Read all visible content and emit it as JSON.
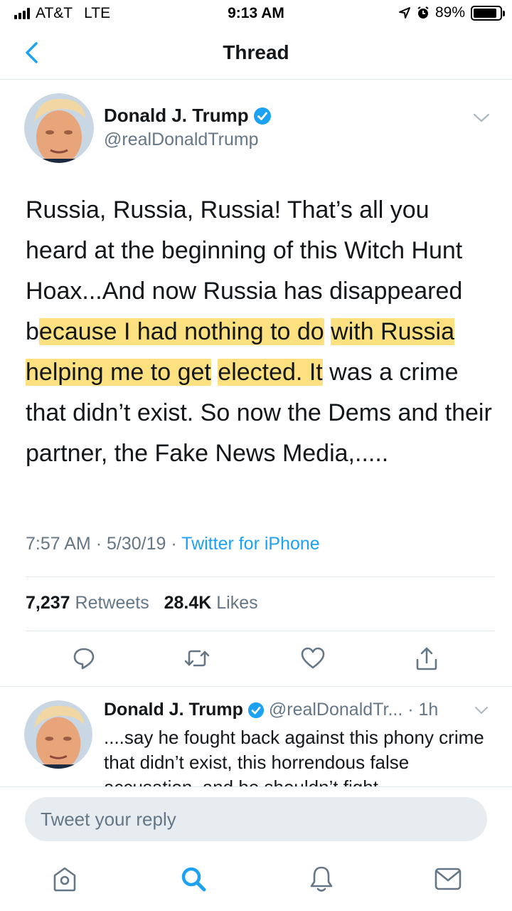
{
  "status_bar": {
    "carrier": "AT&T",
    "network": "LTE",
    "time": "9:13 AM",
    "battery_percent": "89%",
    "battery_level": 0.89
  },
  "nav": {
    "title": "Thread",
    "back_icon": "chevron-left-icon"
  },
  "colors": {
    "accent": "#1da1f2",
    "secondary_text": "#657786",
    "highlight": "#fcd655",
    "divider": "#e1e8ed",
    "input_bg": "#e6ecf0"
  },
  "tweet": {
    "author_name": "Donald J. Trump",
    "author_handle": "@realDonaldTrump",
    "text_parts": {
      "p1": "Russia, Russia, Russia! That’s all you heard at the beginning of this Witch Hunt Hoax...And now Russia has disappeared b",
      "p2": "ecause I had nothing to do",
      "p3": "with Russia helping me to get",
      "p4": "elected. It",
      "p5": " was a crime that didn’t exist. So now the Dems and their partner, the Fake News Media,....."
    },
    "time": "7:57 AM",
    "date": "5/30/19",
    "separator": "·",
    "source": "Twitter for iPhone",
    "retweets_count": "7,237",
    "retweets_label": "Retweets",
    "likes_count": "28.4K",
    "likes_label": "Likes",
    "actions": [
      "reply-icon",
      "retweet-icon",
      "like-icon",
      "share-icon"
    ]
  },
  "reply": {
    "author_name": "Donald J. Trump",
    "meta": "@realDonaldTr... · 1h",
    "text": "....say he fought back against this phony crime that didn’t exist, this horrendous false accusation, and he shouldn’t fight"
  },
  "composer": {
    "placeholder": "Tweet your reply"
  },
  "tab_bar": {
    "items": [
      "home-icon",
      "search-icon",
      "notifications-icon",
      "messages-icon"
    ]
  }
}
